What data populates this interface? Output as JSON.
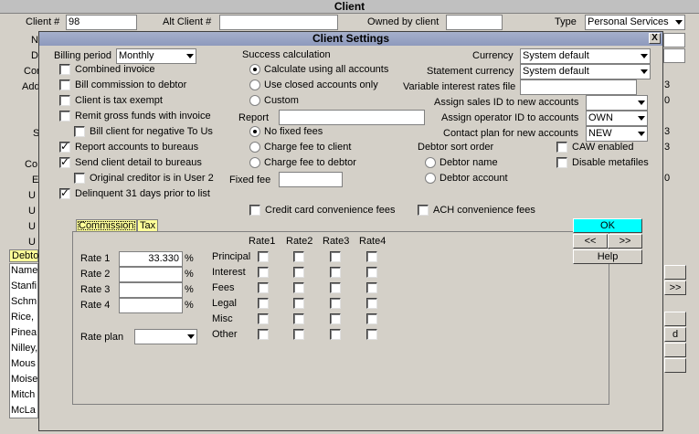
{
  "background": {
    "title": "Client",
    "client_num_label": "Client #",
    "client_num_value": "98",
    "alt_client_label": "Alt Client #",
    "owned_label": "Owned by client",
    "type_label": "Type",
    "type_value": "Personal Services",
    "left_labels": [
      "N",
      "D",
      "Con",
      "Add",
      "S",
      "Co",
      "E",
      "U",
      "U",
      "U",
      "U"
    ],
    "debtor_tab": "Debto",
    "debtor_list": [
      "Name",
      "Stanfi",
      "Schm",
      "Rice,",
      "Pinea",
      "Nilley,",
      "Mous",
      "Moise",
      "Mitch",
      "McLa"
    ],
    "right_snips": [
      "3",
      "0",
      "3",
      "3",
      "0"
    ],
    "right_btn1": ">>",
    "right_btn2": "d"
  },
  "dialog": {
    "title": "Client Settings",
    "close_label": "X",
    "billing_period_label": "Billing period",
    "billing_period_value": "Monthly",
    "left_checks": [
      {
        "label": "Combined invoice",
        "checked": false
      },
      {
        "label": "Bill commission to debtor",
        "checked": false
      },
      {
        "label": "Client is tax exempt",
        "checked": false
      },
      {
        "label": "Remit gross funds with invoice",
        "checked": false
      },
      {
        "label": "Bill client for negative To Us",
        "checked": false
      },
      {
        "label": "Report accounts to bureaus",
        "checked": true
      },
      {
        "label": "Send client detail to bureaus",
        "checked": true
      },
      {
        "label": "Original creditor is in User 2",
        "checked": false
      },
      {
        "label": "Delinquent 31 days prior to list",
        "checked": true
      }
    ],
    "success_calc_label": "Success calculation",
    "success_options": [
      {
        "label": "Calculate using all accounts",
        "selected": true
      },
      {
        "label": "Use closed accounts only",
        "selected": false
      },
      {
        "label": "Custom",
        "selected": false
      }
    ],
    "report_label": "Report",
    "fee_options": [
      {
        "label": "No fixed fees",
        "selected": true
      },
      {
        "label": "Charge fee to client",
        "selected": false
      },
      {
        "label": "Charge fee to debtor",
        "selected": false
      }
    ],
    "fixed_fee_label": "Fixed fee",
    "currency_label": "Currency",
    "currency_value": "System default",
    "statement_currency_label": "Statement currency",
    "statement_currency_value": "System default",
    "variable_rates_label": "Variable interest rates file",
    "assign_sales_label": "Assign sales ID to new accounts",
    "assign_operator_label": "Assign operator ID to accounts",
    "assign_operator_value": "OWN",
    "contact_plan_label": "Contact plan for new accounts",
    "contact_plan_value": "NEW",
    "debtor_sort_label": "Debtor sort order",
    "sort_options": [
      {
        "label": "Debtor name",
        "selected": false
      },
      {
        "label": "Debtor account",
        "selected": false
      }
    ],
    "caw_label": "CAW enabled",
    "disable_meta_label": "Disable metafiles",
    "credit_card_fees_label": "Credit card convenience fees",
    "ach_fees_label": "ACH convenience fees",
    "tabs": [
      "Commission",
      "Tax"
    ],
    "rate_rows": [
      {
        "label": "Rate 1",
        "value": "33.330",
        "unit": "%"
      },
      {
        "label": "Rate 2",
        "value": "",
        "unit": "%"
      },
      {
        "label": "Rate 3",
        "value": "",
        "unit": "%"
      },
      {
        "label": "Rate 4",
        "value": "",
        "unit": "%"
      }
    ],
    "rate_plan_label": "Rate plan",
    "rate_columns": [
      "Rate1",
      "Rate2",
      "Rate3",
      "Rate4"
    ],
    "rate_categories": [
      "Principal",
      "Interest",
      "Fees",
      "Legal",
      "Misc",
      "Other"
    ],
    "ok_label": "OK",
    "prev_label": "<<",
    "next_label": ">>",
    "help_label": "Help",
    "ok_color": "#00ffff"
  }
}
